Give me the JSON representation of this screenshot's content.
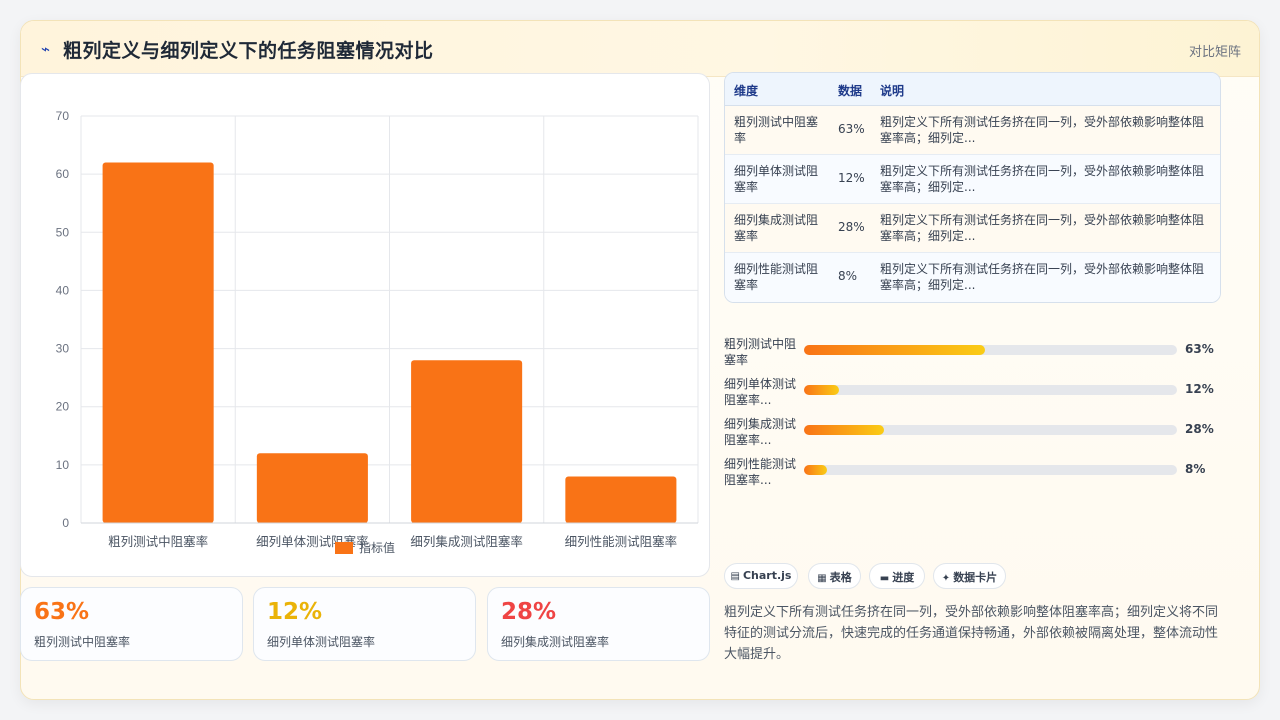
{
  "header": {
    "icon": "chart-line-icon",
    "title": "粗列定义与细列定义下的任务阻塞情况对比",
    "tag": "对比矩阵"
  },
  "chart_data": {
    "type": "bar",
    "categories": [
      "粗列测试中阻塞率",
      "细列单体测试阻塞率",
      "细列集成测试阻塞率",
      "细列性能测试阻塞率"
    ],
    "series": [
      {
        "name": "指标值",
        "values": [
          62,
          12,
          28,
          8
        ]
      }
    ],
    "ylim": [
      0,
      70
    ],
    "yticks": [
      0,
      10,
      20,
      30,
      40,
      50,
      60,
      70
    ],
    "bar_color": "#f97316",
    "legend": "bottom",
    "grid": true
  },
  "kpis": [
    {
      "value": "63%",
      "label": "粗列测试中阻塞率",
      "color": "#f97316"
    },
    {
      "value": "12%",
      "label": "细列单体测试阻塞率",
      "color": "#eab308"
    },
    {
      "value": "28%",
      "label": "细列集成测试阻塞率",
      "color": "#ef4444"
    }
  ],
  "table": {
    "headers": [
      "维度",
      "数据",
      "说明"
    ],
    "rows": [
      {
        "dim": "粗列测试中阻塞率",
        "data": "63%",
        "desc": "粗列定义下所有测试任务挤在同一列，受外部依赖影响整体阻塞率高；细列定..."
      },
      {
        "dim": "细列单体测试阻塞率",
        "data": "12%",
        "desc": "粗列定义下所有测试任务挤在同一列，受外部依赖影响整体阻塞率高；细列定..."
      },
      {
        "dim": "细列集成测试阻塞率",
        "data": "28%",
        "desc": "粗列定义下所有测试任务挤在同一列，受外部依赖影响整体阻塞率高；细列定..."
      },
      {
        "dim": "细列性能测试阻塞率",
        "data": "8%",
        "desc": "粗列定义下所有测试任务挤在同一列，受外部依赖影响整体阻塞率高；细列定..."
      }
    ]
  },
  "progress": [
    {
      "label": "粗列测试中阻塞率",
      "value": "63%",
      "fraction": 0.485
    },
    {
      "label": "细列单体测试阻塞率...",
      "value": "12%",
      "fraction": 0.095
    },
    {
      "label": "细列集成测试阻塞率...",
      "value": "28%",
      "fraction": 0.215
    },
    {
      "label": "细列性能测试阻塞率...",
      "value": "8%",
      "fraction": 0.062
    }
  ],
  "chips": [
    {
      "icon": "chart-icon",
      "glyph": "▤",
      "label": "Chart.js"
    },
    {
      "icon": "table-icon",
      "glyph": "▦",
      "label": "表格"
    },
    {
      "icon": "progress-icon",
      "glyph": "▬",
      "label": "进度"
    },
    {
      "icon": "sparkle-icon",
      "glyph": "✦",
      "label": "数据卡片"
    }
  ],
  "description": "粗列定义下所有测试任务挤在同一列，受外部依赖影响整体阻塞率高；细列定义将不同特征的测试分流后，快速完成的任务通道保持畅通，外部依赖被隔离处理，整体流动性大幅提升。"
}
